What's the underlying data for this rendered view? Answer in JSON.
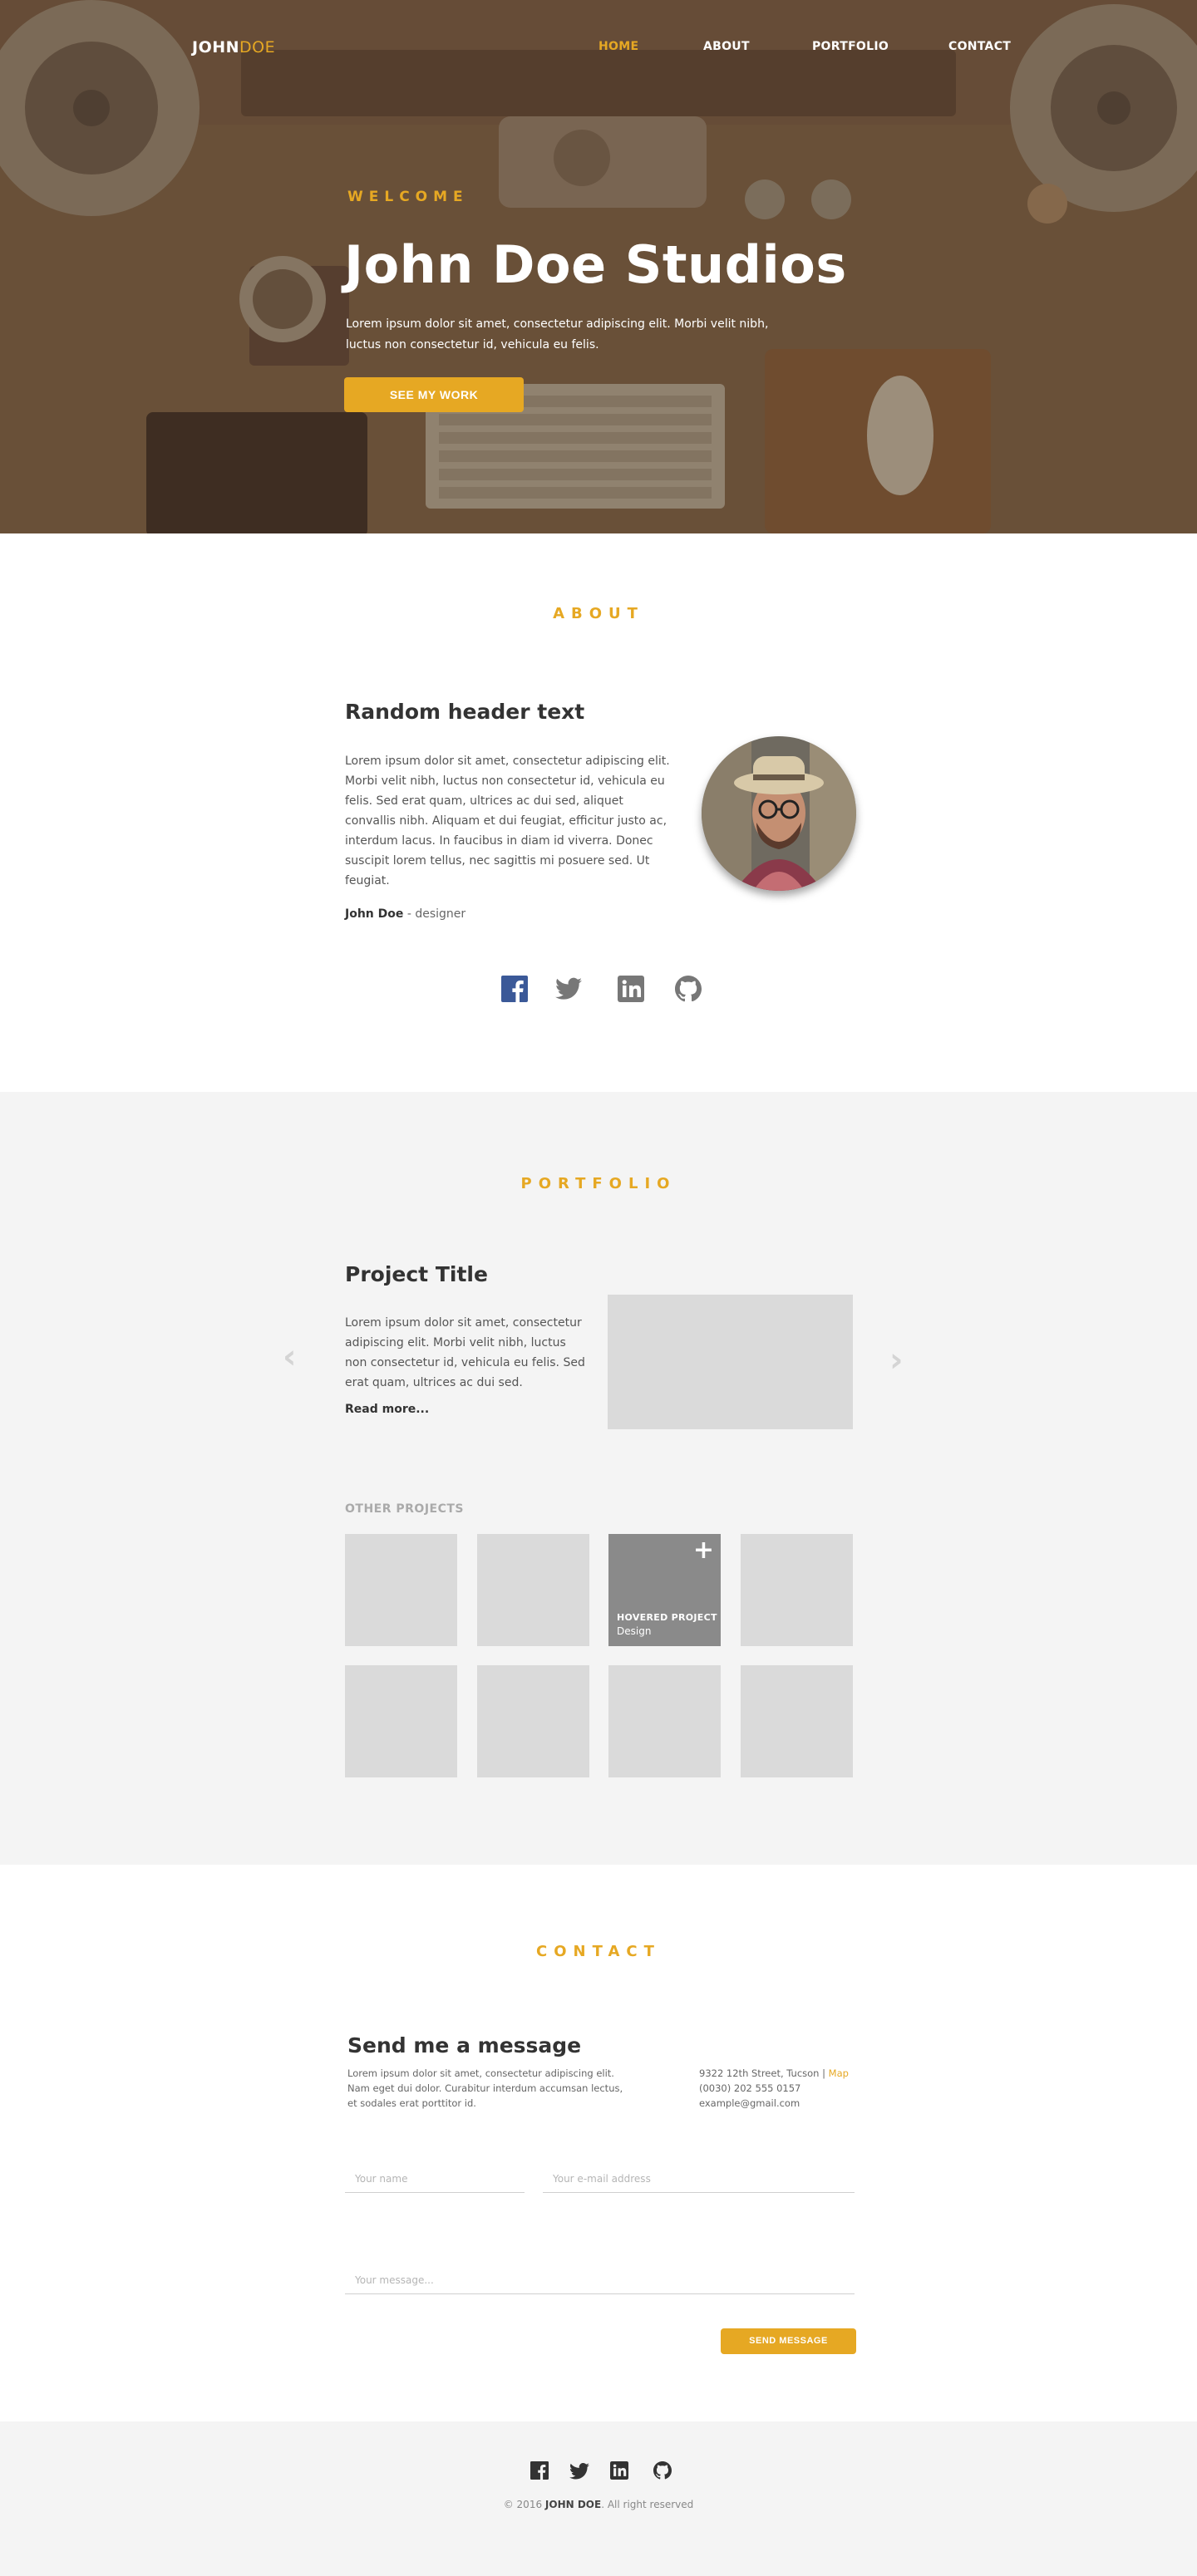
{
  "brand": {
    "first": "JOHN",
    "second": "DOE"
  },
  "nav": {
    "items": [
      {
        "label": "HOME",
        "active": true
      },
      {
        "label": "ABOUT",
        "active": false
      },
      {
        "label": "PORTFOLIO",
        "active": false
      },
      {
        "label": "CONTACT",
        "active": false
      }
    ]
  },
  "hero": {
    "eyebrow": "WELCOME",
    "title": "John Doe Studios",
    "text": "Lorem ipsum dolor sit amet, consectetur adipiscing elit. Morbi velit nibh, luctus non consectetur id, vehicula eu felis.",
    "button": "SEE MY WORK"
  },
  "about": {
    "heading": "ABOUT",
    "title": "Random header text",
    "text": "Lorem ipsum dolor sit amet, consectetur adipiscing elit. Morbi velit nibh, luctus non consectetur id, vehicula eu felis. Sed erat quam, ultrices ac dui sed, aliquet convallis nibh. Aliquam et dui feugiat, efficitur justo ac, interdum lacus. In faucibus in diam id viverra. Donec suscipit lorem tellus, nec sagittis mi posuere sed. Ut feugiat.",
    "author_name": "John Doe",
    "author_role": " - designer",
    "socials": [
      {
        "icon": "facebook-icon",
        "color": "#3b5998"
      },
      {
        "icon": "twitter-icon",
        "color": "#777777"
      },
      {
        "icon": "linkedin-icon",
        "color": "#777777"
      },
      {
        "icon": "github-icon",
        "color": "#777777"
      }
    ]
  },
  "portfolio": {
    "heading": "PORTFOLIO",
    "project_title": "Project Title",
    "project_text": "Lorem ipsum dolor sit amet, consectetur adipiscing elit. Morbi velit nibh, luctus non consectetur id, vehicula eu felis. Sed erat quam, ultrices ac dui sed.",
    "read_more": "Read more...",
    "prev_arrow": "‹",
    "next_arrow": "›",
    "other_label": "OTHER PROJECTS",
    "hovered_title": "HOVERED PROJECT",
    "hovered_category": "Design",
    "hovered_plus": "+"
  },
  "contact": {
    "heading": "CONTACT",
    "title": "Send me a message",
    "text": "Lorem ipsum dolor sit amet, consectetur adipiscing elit. Nam eget dui dolor. Curabitur interdum accumsan lectus, et sodales erat porttitor id.",
    "address": "9322 12th Street, Tucson |",
    "map_link": "Map",
    "phone": "(0030) 202 555 0157",
    "email": "example@gmail.com",
    "name_placeholder": "Your name",
    "email_placeholder": "Your e-mail address",
    "message_placeholder": "Your message...",
    "send_button": "SEND MESSAGE"
  },
  "footer": {
    "copyright_prefix": "© 2016 ",
    "copyright_name": "JOHN DOE",
    "copyright_suffix": ". All right reserved"
  },
  "colors": {
    "accent": "#e6a823",
    "section_bg": "#f4f4f4",
    "placeholder_gray": "#dadada"
  }
}
